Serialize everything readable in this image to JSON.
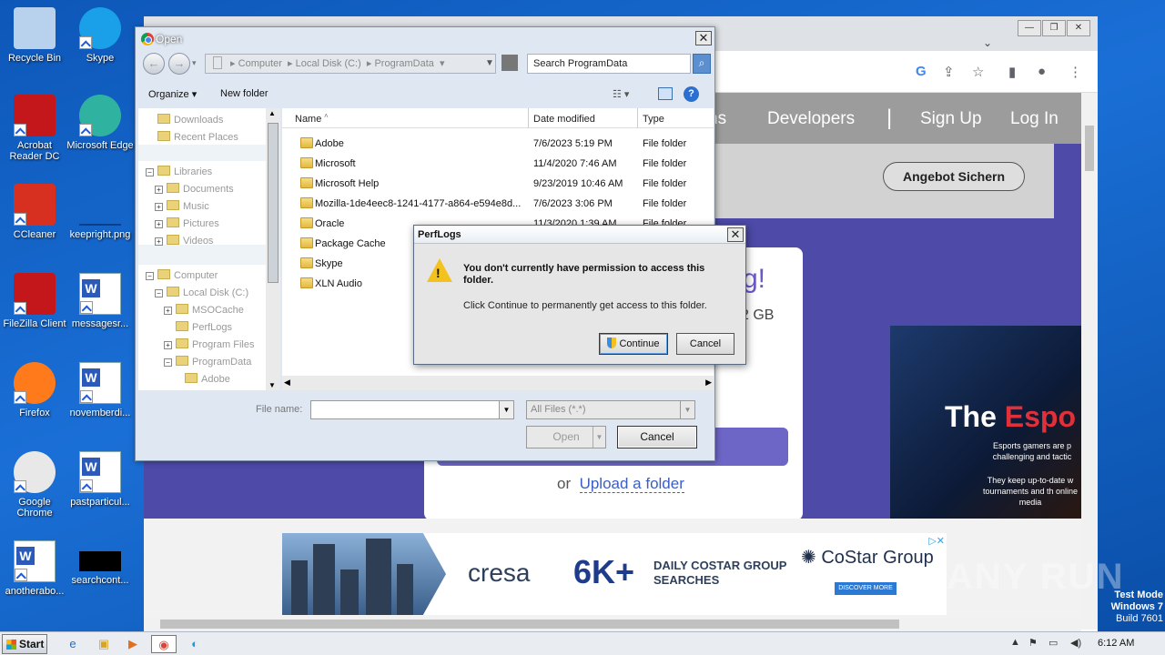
{
  "desktop": {
    "icons": [
      {
        "label": "Recycle Bin",
        "icon": "recycle-bin-icon"
      },
      {
        "label": "Skype",
        "icon": "skype-icon"
      },
      {
        "label": "Acrobat Reader DC",
        "icon": "acrobat-icon"
      },
      {
        "label": "Microsoft Edge",
        "icon": "edge-icon"
      },
      {
        "label": "CCleaner",
        "icon": "ccleaner-icon"
      },
      {
        "label": "keepright.png",
        "icon": "image-file-icon"
      },
      {
        "label": "FileZilla Client",
        "icon": "filezilla-icon"
      },
      {
        "label": "messagesr...",
        "icon": "word-doc-icon"
      },
      {
        "label": "Firefox",
        "icon": "firefox-icon"
      },
      {
        "label": "novemberdi...",
        "icon": "word-doc-icon"
      },
      {
        "label": "Google Chrome",
        "icon": "chrome-icon"
      },
      {
        "label": "pastparticul...",
        "icon": "word-doc-icon"
      },
      {
        "label": "anotherabo...",
        "icon": "word-doc-icon"
      },
      {
        "label": "searchcont...",
        "icon": "black-file-icon"
      }
    ]
  },
  "browser": {
    "nav_links": [
      "ns",
      "Developers",
      "Sign Up",
      "Log In"
    ],
    "angebot_button": "Angebot Sichern",
    "card_heading_fragment": "g!",
    "card_gb_fragment": "2 GB",
    "upload_prefix": "or",
    "upload_link": "Upload a folder",
    "esports_title_white": "The ",
    "esports_title_red": "Espo",
    "esports_line1": "Esports gamers are p challenging and tactic",
    "esports_line2": "They keep up-to-date w tournaments and th online media",
    "ad": {
      "brand": "cresa",
      "big": "6K+",
      "daily_line1": "DAILY COSTAR GROUP",
      "daily_line2": "SEARCHES",
      "costar": "CoStar Group",
      "discover": "DISCOVER MORE"
    }
  },
  "open_dialog": {
    "title": "Open",
    "breadcrumb": [
      "Computer",
      "Local Disk (C:)",
      "ProgramData"
    ],
    "search_placeholder": "Search ProgramData",
    "toolbar": {
      "organize": "Organize ▾",
      "new_folder": "New folder"
    },
    "nav_items": [
      {
        "label": "Downloads",
        "indent": 0,
        "expander": ""
      },
      {
        "label": "Recent Places",
        "indent": 0,
        "expander": ""
      },
      {
        "label": "Libraries",
        "indent": 0,
        "expander": "−"
      },
      {
        "label": "Documents",
        "indent": 1,
        "expander": "+"
      },
      {
        "label": "Music",
        "indent": 1,
        "expander": "+"
      },
      {
        "label": "Pictures",
        "indent": 1,
        "expander": "+"
      },
      {
        "label": "Videos",
        "indent": 1,
        "expander": "+"
      },
      {
        "label": "Computer",
        "indent": 0,
        "expander": "−"
      },
      {
        "label": "Local Disk (C:)",
        "indent": 1,
        "expander": "−"
      },
      {
        "label": "MSOCache",
        "indent": 2,
        "expander": "+"
      },
      {
        "label": "PerfLogs",
        "indent": 2,
        "expander": ""
      },
      {
        "label": "Program Files",
        "indent": 2,
        "expander": "+"
      },
      {
        "label": "ProgramData",
        "indent": 2,
        "expander": "−"
      },
      {
        "label": "Adobe",
        "indent": 3,
        "expander": ""
      }
    ],
    "columns": {
      "name": "Name",
      "date": "Date modified",
      "type": "Type"
    },
    "files": [
      {
        "name": "Adobe",
        "date": "7/6/2023 5:19 PM",
        "type": "File folder"
      },
      {
        "name": "Microsoft",
        "date": "11/4/2020 7:46 AM",
        "type": "File folder"
      },
      {
        "name": "Microsoft Help",
        "date": "9/23/2019 10:46 AM",
        "type": "File folder"
      },
      {
        "name": "Mozilla-1de4eec8-1241-4177-a864-e594e8d...",
        "date": "7/6/2023 3:06 PM",
        "type": "File folder"
      },
      {
        "name": "Oracle",
        "date": "11/3/2020 1:39 AM",
        "type": "File folder"
      },
      {
        "name": "Package Cache",
        "date": "",
        "type": ""
      },
      {
        "name": "Skype",
        "date": "",
        "type": ""
      },
      {
        "name": "XLN Audio",
        "date": "",
        "type": ""
      }
    ],
    "file_name_label": "File name:",
    "file_name_value": "",
    "file_type": "All Files (*.*)",
    "open_button": "Open",
    "cancel_button": "Cancel"
  },
  "message_dialog": {
    "title": "PerfLogs",
    "message": "You don't currently have permission to access this folder.",
    "detail": "Click Continue to permanently get access to this folder.",
    "continue_button": "Continue",
    "cancel_button": "Cancel"
  },
  "taskbar": {
    "start": "Start",
    "time": "6:12 AM"
  },
  "watermark": "ANY RUN",
  "test_mode": [
    "Test Mode",
    "Windows 7",
    "Build 7601"
  ]
}
